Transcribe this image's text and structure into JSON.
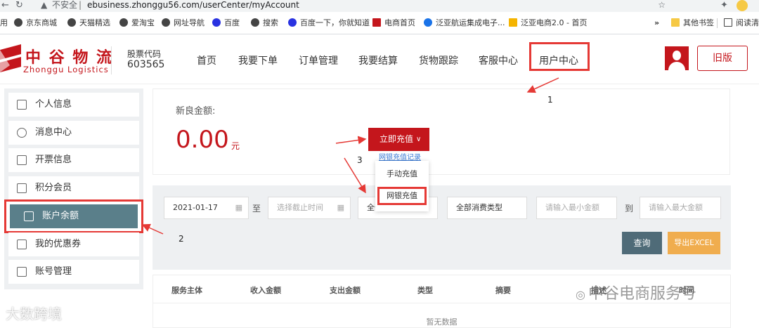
{
  "browser": {
    "insecure_label": "不安全",
    "url": "ebusiness.zhonggu56.com/userCenter/myAccount",
    "bookmarks": [
      "用",
      "京东商城",
      "天猫精选",
      "爱淘宝",
      "网址导航",
      "百度",
      "搜索",
      "百度一下，你就知道",
      "电商首页",
      "泛亚航运集成电子...",
      "泛亚电商2.0 - 首页"
    ],
    "more_bookmarks": "»",
    "other_bookmarks": "其他书签",
    "reading_list": "阅读清"
  },
  "header": {
    "logo_cn": "中 谷 物 流",
    "logo_en": "Zhonggu Logistics",
    "stock_label": "股票代码",
    "stock_code": "603565",
    "nav": [
      "首页",
      "我要下单",
      "订单管理",
      "我要结算",
      "货物跟踪",
      "客服中心",
      "用户中心"
    ],
    "old_version": "旧版"
  },
  "sidebar": {
    "items": [
      "个人信息",
      "消息中心",
      "开票信息",
      "积分会员",
      "账户余额",
      "我的优惠券",
      "账号管理"
    ]
  },
  "balance": {
    "label": "新良金额:",
    "amount": "0.00",
    "unit": "元",
    "recharge_button": "立即充值",
    "recharge_menu": [
      "手动充值",
      "网银充值"
    ],
    "record_link": "网银充值记录"
  },
  "filters": {
    "start_date": "2021-01-17",
    "to_label": "至",
    "end_placeholder": "选择截止时间",
    "status_select": "全部服务主体",
    "type_select": "全部消费类型",
    "min_placeholder": "请输入最小金额",
    "range_label": "到",
    "max_placeholder": "请输入最大金额",
    "query_button": "查询",
    "export_button": "导出EXCEL"
  },
  "table": {
    "headers": [
      "服务主体",
      "收入金额",
      "支出金额",
      "类型",
      "摘要",
      "描述",
      "时间"
    ],
    "empty_text": "暂无数据"
  },
  "annotations": {
    "marker_1": "1",
    "marker_2": "2",
    "marker_3": "3"
  },
  "watermarks": {
    "left": "大数跨境",
    "right": "中谷电商服务号"
  },
  "colors": {
    "brand_red": "#c4161c",
    "annotation_red": "#e53935",
    "active_sidebar": "#5a7f8a",
    "query_button": "#4f6b78",
    "export_button": "#f0ad4e"
  }
}
